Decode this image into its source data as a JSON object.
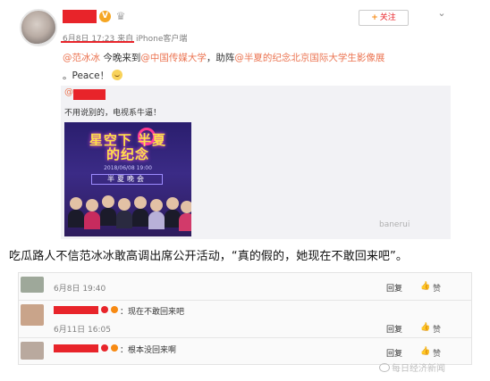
{
  "post": {
    "meta_date": "6月8日 17:23 来自 iPhone客户端",
    "follow_label": "关注",
    "follow_plus": "+",
    "menu_glyph": "⌄",
    "text_at1": "@范冰冰",
    "text_mid1": " 今晚来到",
    "text_at2": "@中国传媒大学",
    "text_mid2": "，助阵",
    "text_at3": "@半夏的纪念北京国际大学生影像展",
    "text_end": "。Peace！"
  },
  "repost": {
    "at": "@",
    "text": "不用说别的，电视系牛逼！",
    "poster_title": "星空下 半夏的纪念",
    "poster_sub": "2018/06/08 19:00",
    "poster_band": "半夏晚会",
    "watermark": "banerui"
  },
  "caption": "吃瓜路人不信范冰冰敢高调出席公开活动，“真的假的，她现在不敢回来吧”。",
  "comments": [
    {
      "time": "6月8日 19:40",
      "reply_label": "回复",
      "like_label": "赞",
      "avatar_color": "#9ea89a"
    },
    {
      "text": "：现在不敢回来吧",
      "time": "6月11日 16:05",
      "reply_label": "回复",
      "like_label": "赞",
      "avatar_color": "#c9a48a"
    },
    {
      "text": "：根本没回来啊",
      "reply_label": "回复",
      "like_label": "赞",
      "avatar_color": "#b9a99e"
    }
  ],
  "watermark_bottom": "每日经济新闻",
  "colors": {
    "accent_red": "#e8242a",
    "link_orange": "#eb7350",
    "vip_gold": "#f5a623"
  },
  "icons": {
    "vip": "V",
    "crown": "♛",
    "like": "👍"
  }
}
